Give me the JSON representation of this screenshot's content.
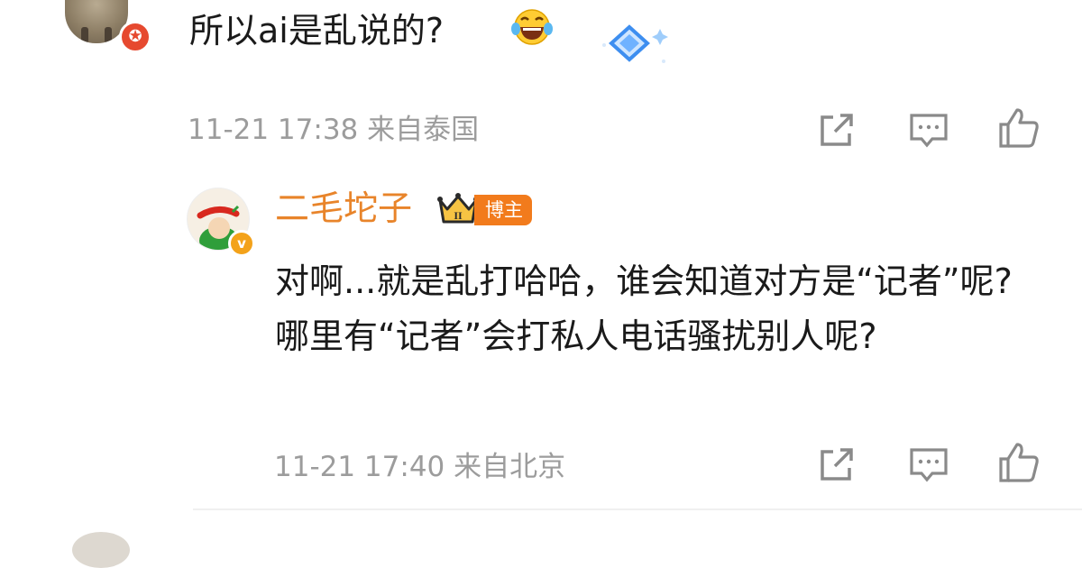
{
  "comment": {
    "avatar_badge_icon": "star-badge-icon",
    "text": "所以ai是乱说的?",
    "emoji_icon": "laughing-tears-emoji-icon",
    "sticker_icon": "diamond-sparkle-icon",
    "timestamp": "11-21 17:38",
    "location": "来自泰国",
    "meta": "11-21 17:38 来自泰国",
    "actions": {
      "share_icon": "share-icon",
      "reply_icon": "comment-icon",
      "like_icon": "thumbs-up-icon"
    }
  },
  "reply": {
    "username": "二毛坨子",
    "crown_icon": "crown-level-icon",
    "crown_level": "II",
    "tag": "博主",
    "verified_icon": "verified-badge-icon",
    "text": "对啊...就是乱打哈哈，谁会知道对方是“记者”呢?哪里有“记者”会打私人电话骚扰别人呢?",
    "timestamp": "11-21 17:40",
    "location": "来自北京",
    "meta": "11-21 17:40 来自北京",
    "actions": {
      "share_icon": "share-icon",
      "reply_icon": "comment-icon",
      "like_icon": "thumbs-up-icon"
    }
  },
  "colors": {
    "username": "#e8842a",
    "tag_bg": "#f27b1c",
    "meta": "#9c9c9c",
    "badge_red": "#e6492f",
    "badge_gold": "#f3a21a"
  }
}
